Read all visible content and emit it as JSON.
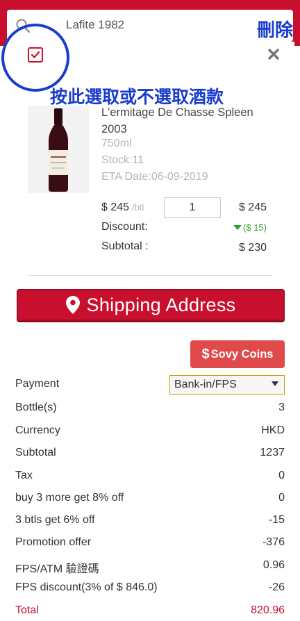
{
  "search": {
    "value": "Lafite 1982"
  },
  "delete_label": "刪除",
  "annotation": "按此選取或不選取酒款",
  "product": {
    "name": "L'ermitage De Chasse Spleen 2003",
    "volume": "750ml",
    "stock": "Stock:11",
    "eta": "ETA Date:06-09-2019",
    "unit_price": "$ 245",
    "unit_suffix": "/btl",
    "quantity": "1",
    "line_total": "$ 245",
    "discount_label": "Discount:",
    "discount_value": "($ 15)",
    "subtotal_label": "Subtotal :",
    "subtotal_value": "$ 230"
  },
  "shipping_button": "Shipping Address",
  "coins_button": {
    "symbol": "$",
    "label": "Sovy Coins"
  },
  "payment": {
    "label": "Payment",
    "selected": "Bank-in/FPS"
  },
  "summary": [
    {
      "label": "Bottle(s)",
      "value": "3"
    },
    {
      "label": "Currency",
      "value": "HKD"
    },
    {
      "label": "Subtotal",
      "value": "1237"
    },
    {
      "label": "Tax",
      "value": "0"
    },
    {
      "label": "buy 3 more get 8% off",
      "value": "0"
    },
    {
      "label": "3 btls get 6% off",
      "value": "-15"
    },
    {
      "label": "Promotion offer",
      "value": "-376"
    },
    {
      "label": "FPS/ATM 驗證碼",
      "value": "0.96"
    },
    {
      "label": "FPS discount(3% of $ 846.0)",
      "value": "-26"
    },
    {
      "label": "Total",
      "value": "820.96"
    }
  ],
  "colors": {
    "brand_red": "#c8102e",
    "annotation_blue": "#1a3ccc",
    "discount_green": "#2e9e2e"
  }
}
